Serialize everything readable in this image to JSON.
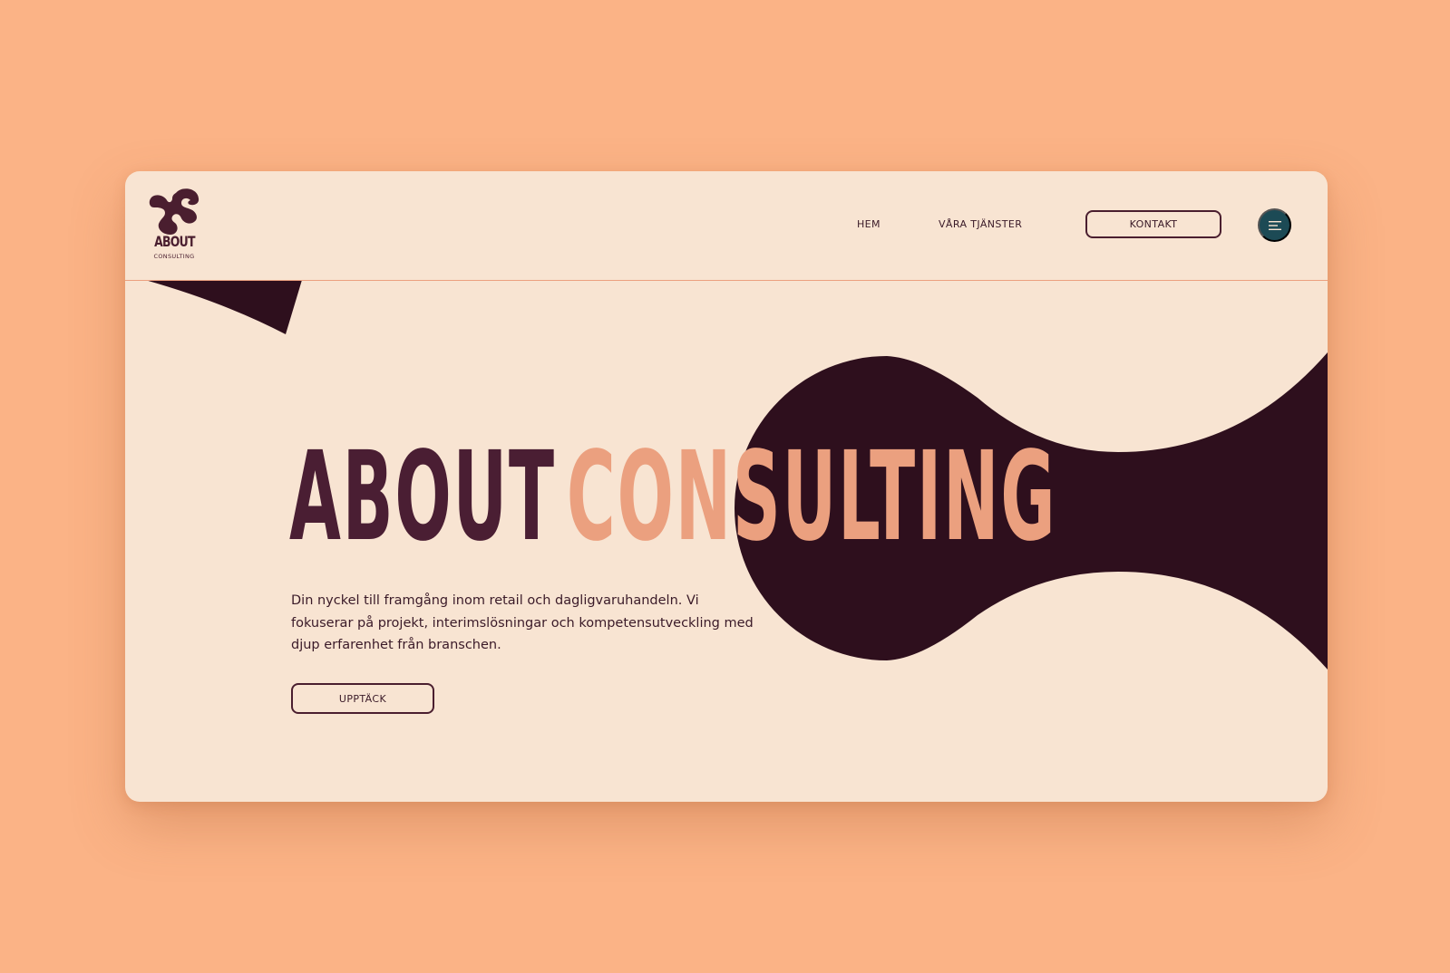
{
  "brand": {
    "logo_word": "ABOUT",
    "logo_sub": "CONSULTING"
  },
  "nav": {
    "home": "HEM",
    "services": "VÅRA TJÄNSTER",
    "contact": "KONTAKT",
    "menu_icon": "hamburger-menu-icon"
  },
  "hero": {
    "title_part1": "ABOUT",
    "title_part2": "CONSULTING",
    "lead": "Din nyckel till framgång inom retail och dagligvaruhandeln. Vi fokuserar på projekt, interimslösningar och kompetensutveckling med djup erfarenhet från branschen.",
    "cta": "UPPTÄCK"
  },
  "colors": {
    "page_background": "#fbb386",
    "card_background": "#f8e4d2",
    "dark_plum": "#2e0f1d",
    "title_plum": "#4a1e33",
    "accent_salmon": "#eba07f",
    "menu_button": "#1c4a55"
  }
}
